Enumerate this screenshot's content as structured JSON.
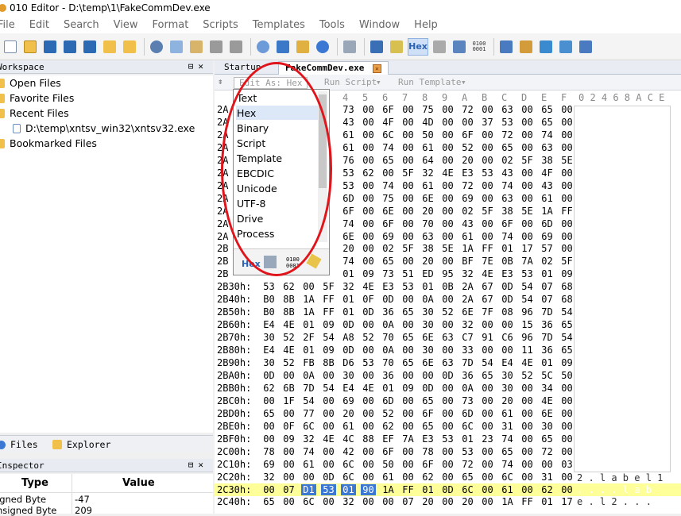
{
  "window": {
    "title": "010 Editor - D:\\temp\\1\\FakeCommDev.exe"
  },
  "menu": [
    "File",
    "Edit",
    "Search",
    "View",
    "Format",
    "Scripts",
    "Templates",
    "Tools",
    "Window",
    "Help"
  ],
  "toolbar": {
    "hex_label": "Hex",
    "binary_label_1": "0100",
    "binary_label_2": "0001"
  },
  "workspace": {
    "title": "Workspace",
    "items": [
      "Open Files",
      "Favorite Files",
      "Recent Files",
      "D:\\temp\\xntsv_win32\\xntsv32.exe",
      "Bookmarked Files"
    ]
  },
  "bottom_tabs": [
    "Files",
    "Explorer"
  ],
  "inspector": {
    "title": "Inspector",
    "col_type": "Type",
    "col_value": "Value",
    "rows": [
      {
        "type": "igned Byte",
        "value": "-47"
      },
      {
        "type": "nsigned Byte",
        "value": "209"
      }
    ]
  },
  "tabs": [
    {
      "label": "Startup"
    },
    {
      "label": "FakeCommDev.exe"
    }
  ],
  "editbar": {
    "edit_as": "Edit As: Hex",
    "run_script": "Run Script",
    "run_template": "Run Template"
  },
  "hex_header": {
    "cols": [
      "4",
      "5",
      "6",
      "7",
      "8",
      "9",
      "A",
      "B",
      "C",
      "D",
      "E",
      "F"
    ],
    "ascii": "0 2 4 6 8 A C E"
  },
  "hex_rows": [
    {
      "addr": "2A",
      "bytes": [
        "73",
        "00",
        "6F",
        "00",
        "75",
        "00",
        "72",
        "00",
        "63",
        "00",
        "65",
        "00"
      ]
    },
    {
      "addr": "2A",
      "bytes": [
        "43",
        "00",
        "4F",
        "00",
        "4D",
        "00",
        "00",
        "37",
        "53",
        "00",
        "65",
        "00"
      ]
    },
    {
      "addr": "2A",
      "bytes": [
        "61",
        "00",
        "6C",
        "00",
        "50",
        "00",
        "6F",
        "00",
        "72",
        "00",
        "74",
        "00"
      ]
    },
    {
      "addr": "2A",
      "bytes": [
        "61",
        "00",
        "74",
        "00",
        "61",
        "00",
        "52",
        "00",
        "65",
        "00",
        "63",
        "00"
      ]
    },
    {
      "addr": "2A",
      "bytes": [
        "76",
        "00",
        "65",
        "00",
        "64",
        "00",
        "20",
        "00",
        "02",
        "5F",
        "38",
        "5E"
      ]
    },
    {
      "addr": "2A",
      "bytes": [
        "53",
        "62",
        "00",
        "5F",
        "32",
        "4E",
        "E3",
        "53",
        "43",
        "00",
        "4F",
        "00"
      ]
    },
    {
      "addr": "2A",
      "bytes": [
        "53",
        "00",
        "74",
        "00",
        "61",
        "00",
        "72",
        "00",
        "74",
        "00",
        "43",
        "00"
      ]
    },
    {
      "addr": "2A",
      "bytes": [
        "6D",
        "00",
        "75",
        "00",
        "6E",
        "00",
        "69",
        "00",
        "63",
        "00",
        "61",
        "00"
      ]
    },
    {
      "addr": "2A",
      "bytes": [
        "6F",
        "00",
        "6E",
        "00",
        "20",
        "00",
        "02",
        "5F",
        "38",
        "5E",
        "1A",
        "FF"
      ]
    },
    {
      "addr": "2A",
      "bytes": [
        "74",
        "00",
        "6F",
        "00",
        "70",
        "00",
        "43",
        "00",
        "6F",
        "00",
        "6D",
        "00"
      ]
    },
    {
      "addr": "2A",
      "bytes": [
        "6E",
        "00",
        "69",
        "00",
        "63",
        "00",
        "61",
        "00",
        "74",
        "00",
        "69",
        "00"
      ]
    },
    {
      "addr": "2B",
      "bytes": [
        "20",
        "00",
        "02",
        "5F",
        "38",
        "5E",
        "1A",
        "FF",
        "01",
        "17",
        "57",
        "00"
      ]
    },
    {
      "addr": "2B",
      "bytes": [
        "74",
        "00",
        "65",
        "00",
        "20",
        "00",
        "BF",
        "7E",
        "0B",
        "7A",
        "02",
        "5F"
      ]
    },
    {
      "addr": "2B",
      "bytes": [
        "01",
        "09",
        "73",
        "51",
        "ED",
        "95",
        "32",
        "4E",
        "E3",
        "53",
        "01",
        "09"
      ]
    },
    {
      "addr": "2B30h:",
      "bytes": [
        "53",
        "62",
        "00",
        "5F",
        "32",
        "4E",
        "E3",
        "53",
        "01",
        "0B",
        "2A",
        "67",
        "0D",
        "54",
        "07",
        "68"
      ]
    },
    {
      "addr": "2B40h:",
      "bytes": [
        "B0",
        "8B",
        "1A",
        "FF",
        "01",
        "0F",
        "0D",
        "00",
        "0A",
        "00",
        "2A",
        "67",
        "0D",
        "54",
        "07",
        "68"
      ]
    },
    {
      "addr": "2B50h:",
      "bytes": [
        "B0",
        "8B",
        "1A",
        "FF",
        "01",
        "0D",
        "36",
        "65",
        "30",
        "52",
        "6E",
        "7F",
        "08",
        "96",
        "7D",
        "54"
      ]
    },
    {
      "addr": "2B60h:",
      "bytes": [
        "E4",
        "4E",
        "01",
        "09",
        "0D",
        "00",
        "0A",
        "00",
        "30",
        "00",
        "32",
        "00",
        "00",
        "15",
        "36",
        "65"
      ]
    },
    {
      "addr": "2B70h:",
      "bytes": [
        "30",
        "52",
        "2F",
        "54",
        "A8",
        "52",
        "70",
        "65",
        "6E",
        "63",
        "C7",
        "91",
        "C6",
        "96",
        "7D",
        "54"
      ]
    },
    {
      "addr": "2B80h:",
      "bytes": [
        "E4",
        "4E",
        "01",
        "09",
        "0D",
        "00",
        "0A",
        "00",
        "30",
        "00",
        "33",
        "00",
        "00",
        "11",
        "36",
        "65"
      ]
    },
    {
      "addr": "2B90h:",
      "bytes": [
        "30",
        "52",
        "FB",
        "8B",
        "D6",
        "53",
        "70",
        "65",
        "6E",
        "63",
        "7D",
        "54",
        "E4",
        "4E",
        "01",
        "09"
      ]
    },
    {
      "addr": "2BA0h:",
      "bytes": [
        "0D",
        "00",
        "0A",
        "00",
        "30",
        "00",
        "36",
        "00",
        "00",
        "0D",
        "36",
        "65",
        "30",
        "52",
        "5C",
        "50"
      ]
    },
    {
      "addr": "2BB0h:",
      "bytes": [
        "62",
        "6B",
        "7D",
        "54",
        "E4",
        "4E",
        "01",
        "09",
        "0D",
        "00",
        "0A",
        "00",
        "30",
        "00",
        "34",
        "00"
      ]
    },
    {
      "addr": "2BC0h:",
      "bytes": [
        "00",
        "1F",
        "54",
        "00",
        "69",
        "00",
        "6D",
        "00",
        "65",
        "00",
        "73",
        "00",
        "20",
        "00",
        "4E",
        "00"
      ]
    },
    {
      "addr": "2BD0h:",
      "bytes": [
        "65",
        "00",
        "77",
        "00",
        "20",
        "00",
        "52",
        "00",
        "6F",
        "00",
        "6D",
        "00",
        "61",
        "00",
        "6E",
        "00"
      ]
    },
    {
      "addr": "2BE0h:",
      "bytes": [
        "00",
        "0F",
        "6C",
        "00",
        "61",
        "00",
        "62",
        "00",
        "65",
        "00",
        "6C",
        "00",
        "31",
        "00",
        "30",
        "00"
      ]
    },
    {
      "addr": "2BF0h:",
      "bytes": [
        "00",
        "09",
        "32",
        "4E",
        "4C",
        "88",
        "EF",
        "7A",
        "E3",
        "53",
        "01",
        "23",
        "74",
        "00",
        "65",
        "00"
      ]
    },
    {
      "addr": "2C00h:",
      "bytes": [
        "78",
        "00",
        "74",
        "00",
        "42",
        "00",
        "6F",
        "00",
        "78",
        "00",
        "53",
        "00",
        "65",
        "00",
        "72",
        "00"
      ]
    },
    {
      "addr": "2C10h:",
      "bytes": [
        "69",
        "00",
        "61",
        "00",
        "6C",
        "00",
        "50",
        "00",
        "6F",
        "00",
        "72",
        "00",
        "74",
        "00",
        "00",
        "03"
      ]
    },
    {
      "addr": "2C20h:",
      "bytes": [
        "32",
        "00",
        "00",
        "0D",
        "6C",
        "00",
        "61",
        "00",
        "62",
        "00",
        "65",
        "00",
        "6C",
        "00",
        "31",
        "00"
      ]
    },
    {
      "addr": "2C30h:",
      "bytes": [
        "00",
        "07",
        "D1",
        "53",
        "01",
        "90",
        "1A",
        "FF",
        "01",
        "0D",
        "6C",
        "00",
        "61",
        "00",
        "62",
        "00"
      ]
    },
    {
      "addr": "2C40h:",
      "bytes": [
        "65",
        "00",
        "6C",
        "00",
        "32",
        "00",
        "00",
        "07",
        "20",
        "00",
        "20",
        "00",
        "1A",
        "FF",
        "01",
        "17"
      ]
    }
  ],
  "ascii_rows": [
    "2 . l a b e l 1",
    ". . . . l a b",
    "e . l 2 . . ."
  ],
  "popup": {
    "options": [
      "Text",
      "Hex",
      "Binary",
      "Script",
      "Template",
      "EBCDIC",
      "Unicode",
      "UTF-8",
      "Drive",
      "Process"
    ],
    "selected": "Hex",
    "footer_hex": "Hex",
    "footer_bin_1": "0100",
    "footer_bin_2": "0001"
  }
}
